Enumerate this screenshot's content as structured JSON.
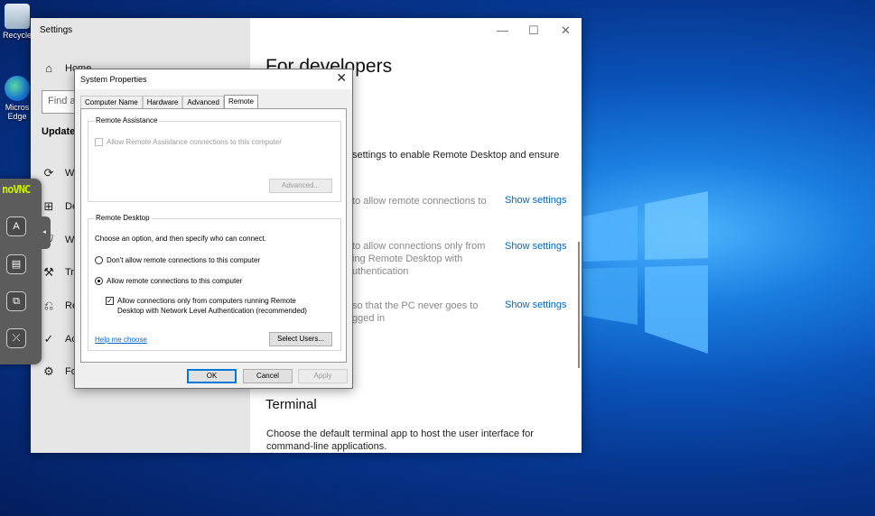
{
  "desktop": {
    "icons": [
      {
        "label": "Recycle"
      },
      {
        "label": "Micros Edge"
      }
    ]
  },
  "settings": {
    "title": "Settings",
    "window_controls": {
      "minimize": "—",
      "maximize": "☐",
      "close": "✕"
    },
    "nav": {
      "home": "Home",
      "find_placeholder": "Find a",
      "section": "Update",
      "items": [
        {
          "icon": "sync-icon",
          "label": "Wi"
        },
        {
          "icon": "delivery-icon",
          "label": "De"
        },
        {
          "icon": "windows-security-icon",
          "label": "Wi"
        },
        {
          "icon": "troubleshoot-icon",
          "label": "Tro"
        },
        {
          "icon": "recovery-icon",
          "label": "Re"
        },
        {
          "icon": "activation-icon",
          "label": "Ac"
        },
        {
          "icon": "developers-icon",
          "label": "Fo"
        }
      ]
    },
    "content": {
      "page_title": "For developers",
      "remote_heading_fragment": "op",
      "remote_desc": "settings to enable Remote Desktop and ensure",
      "rows": [
        {
          "text_lines": [
            "to allow remote connections to"
          ],
          "link": "Show settings"
        },
        {
          "text_lines": [
            "to allow connections only from",
            "ing Remote Desktop with",
            "uthentication"
          ],
          "link": "Show settings"
        },
        {
          "text_lines": [
            "so that the PC never goes to",
            "gged in"
          ],
          "link": "Show settings"
        }
      ],
      "terminal_heading": "Terminal",
      "terminal_desc_lines": [
        "Choose the default terminal app to host the user interface for",
        "command-line applications."
      ]
    }
  },
  "dialog": {
    "title": "System Properties",
    "close": "✕",
    "tabs": [
      "Computer Name",
      "Hardware",
      "Advanced",
      "Remote"
    ],
    "active_tab": "Remote",
    "remote_assistance": {
      "group_label": "Remote Assistance",
      "allow_label": "Allow Remote Assistance connections to this computer",
      "allow_checked": false,
      "advanced_button": "Advanced..."
    },
    "remote_desktop": {
      "group_label": "Remote Desktop",
      "instruction": "Choose an option, and then specify who can connect.",
      "option_dont_allow": "Don't allow remote connections to this computer",
      "option_allow": "Allow remote connections to this computer",
      "selected": "allow",
      "nla_label_line1": "Allow connections only from computers running Remote",
      "nla_label_line2": "Desktop with Network Level Authentication (recommended)",
      "nla_checked": true,
      "help_link": "Help me choose",
      "select_users_button": "Select Users..."
    },
    "buttons": {
      "ok": "OK",
      "cancel": "Cancel",
      "apply": "Apply"
    }
  },
  "novnc": {
    "logo": "noVNC",
    "handle": "◂",
    "buttons": [
      {
        "icon": "keyboard-icon",
        "glyph": "A"
      },
      {
        "icon": "clipboard-icon",
        "glyph": "▤"
      },
      {
        "icon": "fullscreen-icon",
        "glyph": "⧉"
      },
      {
        "icon": "disconnect-icon",
        "glyph": "⤫"
      }
    ]
  },
  "colors": {
    "accent": "#0078d7",
    "link": "#0067c0",
    "vnc_logo": "#c8f000"
  }
}
